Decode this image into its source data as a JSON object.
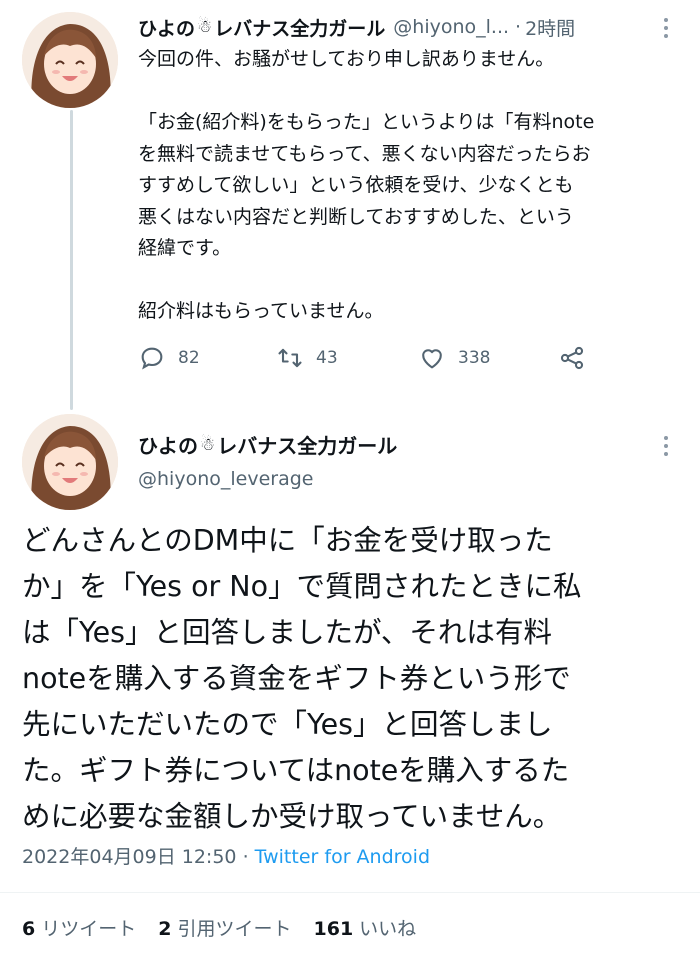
{
  "reply": {
    "display_name": "ひよの",
    "name_icon": "snowman-icon",
    "name_suffix": "レバナス全力ガール",
    "handle": "@hiyono_l...",
    "separator": "·",
    "time": "2時間",
    "text": "今回の件、お騒がせしており申し訳ありません。\n\n「お金(紹介料)をもらった」というよりは「有料note\nを無料で読ませてもらって、悪くない内容だったらお\nすすめして欲しい」という依頼を受け、少なくとも\n悪くはない内容だと判断しておすすめした、という\n経緯です。\n\n紹介料はもらっていません。",
    "actions": {
      "replies": "82",
      "retweets": "43",
      "likes": "338"
    }
  },
  "tweet": {
    "display_name": "ひよの",
    "name_icon": "snowman-icon",
    "name_suffix": "レバナス全力ガール",
    "handle": "@hiyono_leverage",
    "text": "どんさんとのDM中に「お金を受け取った\nか」を「Yes or No」で質問されたときに私\nは「Yes」と回答しましたが、それは有料\nnoteを購入する資金をギフト券という形で\n先にいただいたので「Yes」と回答しまし\nた。ギフト券についてはnoteを購入するた\nめに必要な金額しか受け取っていません。",
    "date": "2022年04月09日 12:50",
    "separator": "·",
    "source": "Twitter for Android",
    "stats": {
      "retweets_count": "6",
      "retweets_label": "リツイート",
      "quotes_count": "2",
      "quotes_label": "引用ツイート",
      "likes_count": "161",
      "likes_label": "いいね"
    }
  },
  "colors": {
    "text": "#0f1419",
    "secondary": "#536471",
    "link": "#1d9bf0",
    "thread_line": "#cfd9de"
  }
}
